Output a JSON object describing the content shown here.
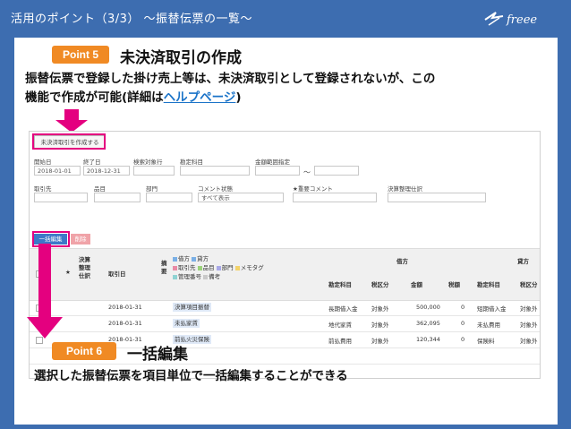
{
  "header": {
    "title": "活用のポイント（3/3） 〜振替伝票の一覧〜",
    "logo_text": "freee"
  },
  "point5": {
    "badge": "Point 5",
    "title": "未決済取引の作成",
    "desc_line1": "振替伝票で登録した掛け売上等は、未決済取引として登録されないが、この",
    "desc_line2_pre": "機能で作成が可能(詳細は",
    "desc_link": "ヘルプページ",
    "desc_line2_post": ")"
  },
  "point6": {
    "badge": "Point 6",
    "title": "一括編集",
    "desc": "選択した振替伝票を項目単位で一括編集することができる"
  },
  "screen": {
    "create_button": "未決済取引を作成する",
    "filters": {
      "start_label": "開始日",
      "start_value": "2018-01-01",
      "end_label": "終了日",
      "end_value": "2018-12-31",
      "search_target_label": "検索対象行",
      "account_label": "勘定科目",
      "amount_label": "金額範囲指定",
      "tilde": "〜",
      "partner_label": "取引先",
      "item_label": "品目",
      "dept_label": "部門",
      "comment_label": "コメント状態",
      "comment_value": "すべて表示",
      "important_label": "★重要コメント",
      "settle_label": "決算整理仕訳"
    },
    "bulk_button": "一括編集",
    "delete_button": "削除",
    "table": {
      "col_star": "★",
      "col_settle": "決算整理仕訳",
      "col_date": "取引日",
      "col_summary": "摘要",
      "debit_header": "借方",
      "credit_header": "貸方",
      "legend": [
        "借方",
        "貸方",
        "取引先",
        "品目",
        "部門",
        "メモタグ",
        "管理番号",
        "備考"
      ],
      "sub_headers": [
        "勘定科目",
        "税区分",
        "金額",
        "税額",
        "勘定科目",
        "税区分"
      ],
      "rows": [
        {
          "date": "2018-01-31",
          "tag": "決算項目振替",
          "debit_account": "長期借入金",
          "debit_tax": "対象外",
          "amount": "500,000",
          "tax": "0",
          "credit_account": "短期借入金",
          "credit_tax": "対象外"
        },
        {
          "date": "2018-01-31",
          "tag": "未払家賃",
          "debit_account": "地代家賃",
          "debit_tax": "対象外",
          "amount": "362,095",
          "tax": "0",
          "credit_account": "未払費用",
          "credit_tax": "対象外"
        },
        {
          "date": "2018-01-31",
          "tag": "前払火災保険",
          "debit_account": "前払費用",
          "debit_tax": "対象外",
          "amount": "120,344",
          "tax": "0",
          "credit_account": "保険料",
          "credit_tax": "対象外"
        }
      ]
    }
  },
  "colors": {
    "header_bg": "#3d6db0",
    "badge": "#f08a24",
    "highlight": "#e4007f",
    "link": "#1a73c8",
    "bulk_button": "#3d78c8"
  }
}
